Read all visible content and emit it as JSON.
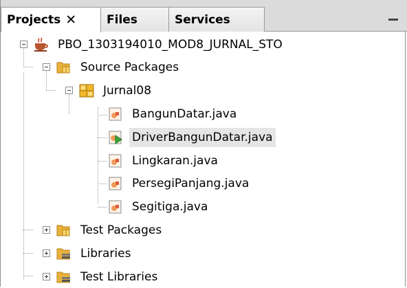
{
  "tabs": [
    {
      "label": "Projects",
      "close": "✕",
      "active": true
    },
    {
      "label": "Files"
    },
    {
      "label": "Services"
    }
  ],
  "tree": {
    "project": "PBO_1303194010_MOD8_JURNAL_STO",
    "source_packages": "Source Packages",
    "package": "Jurnal08",
    "files": [
      "BangunDatar.java",
      "DriverBangunDatar.java",
      "Lingkaran.java",
      "PersegiPanjang.java",
      "Segitiga.java"
    ],
    "test_packages": "Test Packages",
    "libraries": "Libraries",
    "test_libraries": "Test Libraries"
  },
  "colors": {
    "folder": "#e8b23a",
    "package": "#f2b92c",
    "java_file": "#f09a5c",
    "selection": "#e5e5e5"
  }
}
